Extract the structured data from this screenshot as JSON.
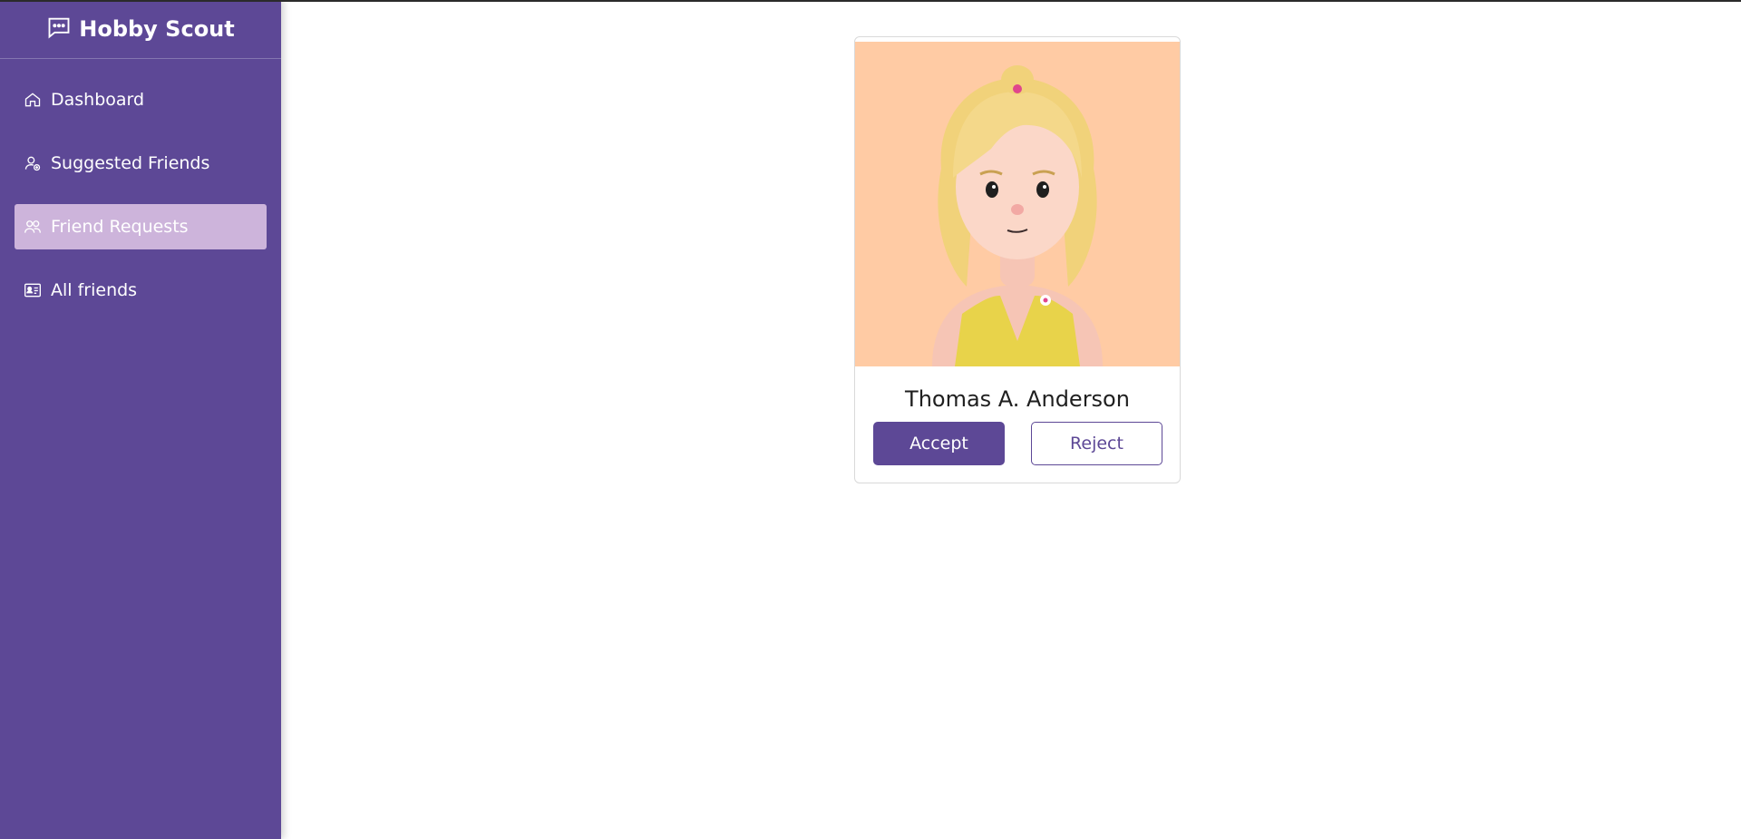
{
  "app": {
    "title": "Hobby Scout"
  },
  "sidebar": {
    "items": [
      {
        "label": "Dashboard",
        "icon": "home-icon",
        "active": false
      },
      {
        "label": "Suggested Friends",
        "icon": "user-plus-icon",
        "active": false
      },
      {
        "label": "Friend Requests",
        "icon": "users-icon",
        "active": true
      },
      {
        "label": "All friends",
        "icon": "id-card-icon",
        "active": false
      }
    ]
  },
  "request": {
    "name": "Thomas A. Anderson",
    "accept_label": "Accept",
    "reject_label": "Reject"
  },
  "colors": {
    "primary": "#5d4896",
    "active_nav": "#cdb4db",
    "avatar_bg": "#ffcba4"
  }
}
